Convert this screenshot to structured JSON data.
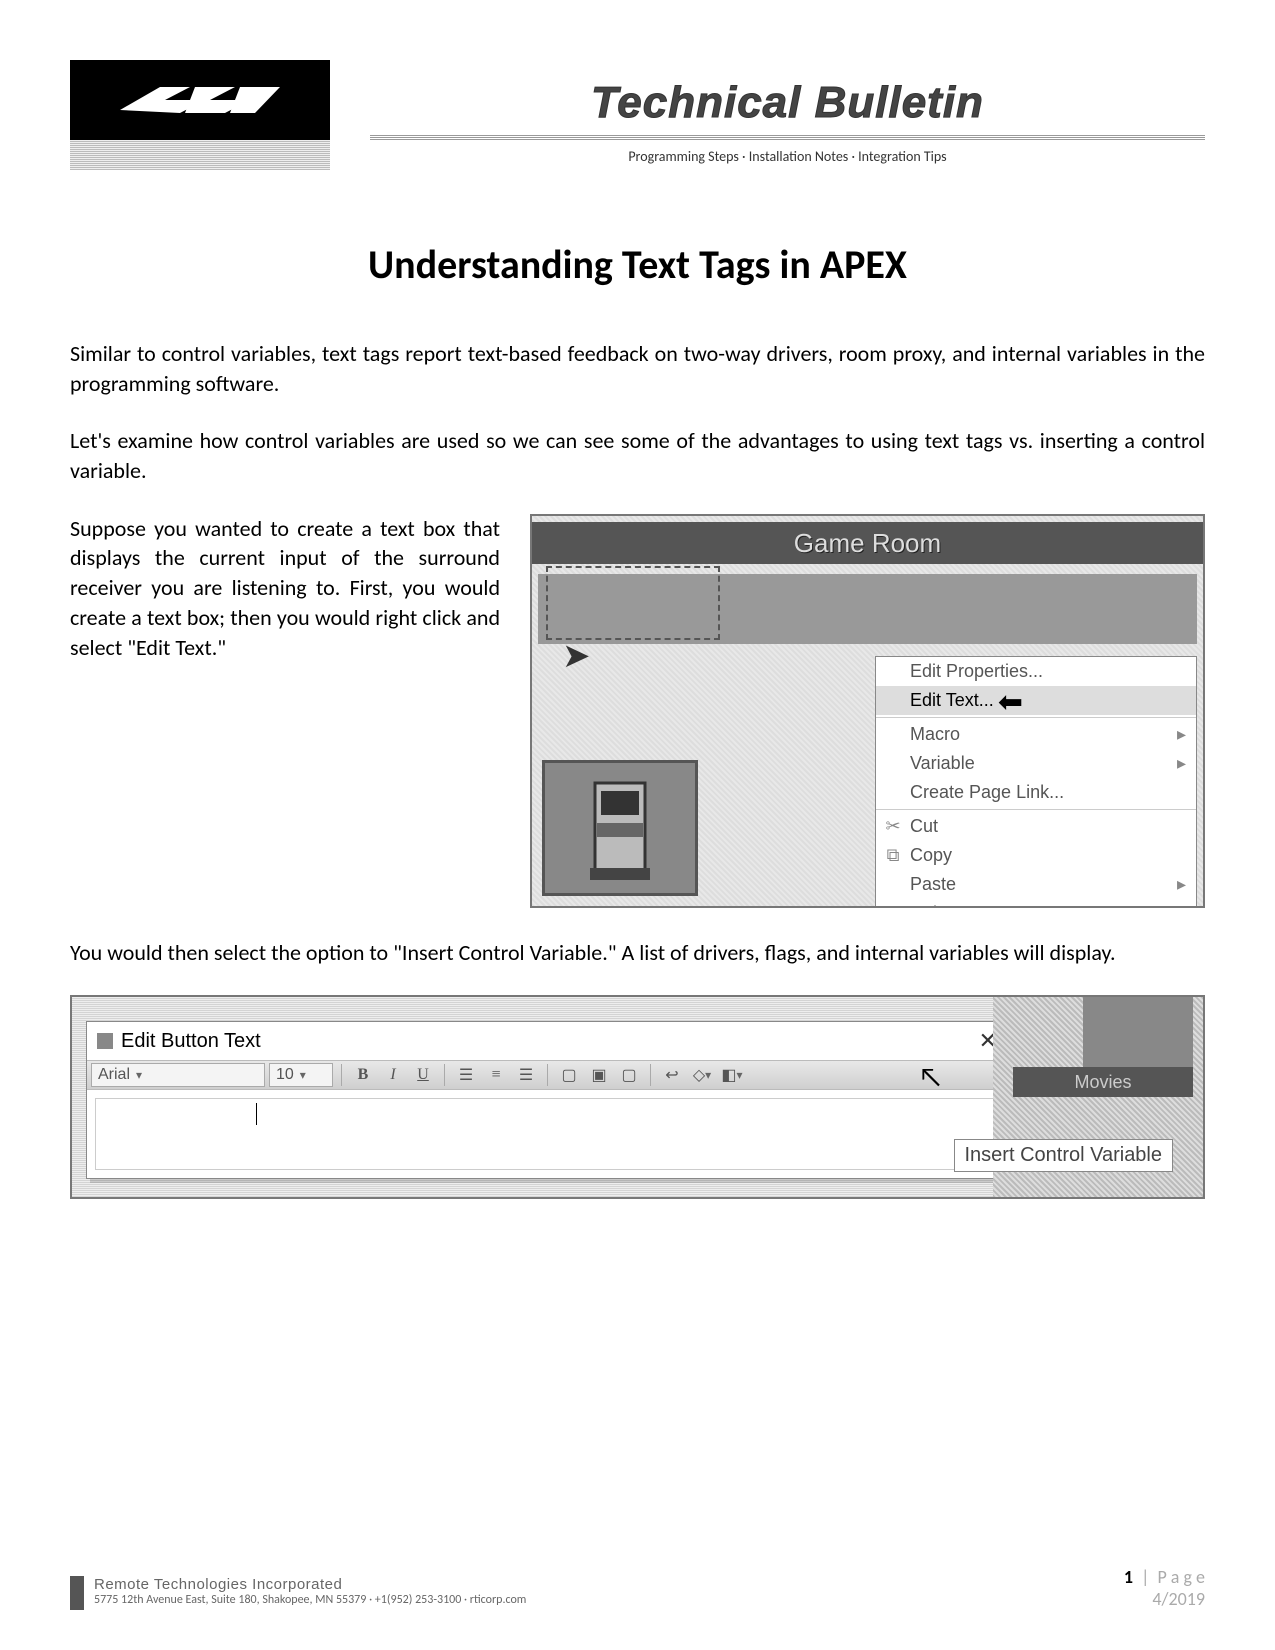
{
  "header": {
    "brand_title": "Technical Bulletin",
    "subtitle": "Programming Steps · Installation Notes · Integration Tips"
  },
  "document": {
    "title": "Understanding Text Tags in APEX",
    "para1": "Similar to control variables, text tags report text-based feedback on two-way drivers, room proxy, and internal variables in the programming software.",
    "para2": "Let's examine how control variables are used so we can see some of the advantages to using text tags vs. inserting a control variable.",
    "para3": "Suppose you wanted to create a text box that displays the current input of the surround receiver you are listening to.  First, you would create a text box; then you would right click and select \"Edit Text.\"",
    "para4": "You would then select the option to \"Insert Control Variable.\"  A list of drivers, flags, and internal variables will display."
  },
  "screenshot1": {
    "room_title": "Game Room",
    "context_menu": [
      {
        "label": "Edit Properties...",
        "submenu": false,
        "highlight": false
      },
      {
        "label": "Edit Text...",
        "submenu": false,
        "highlight": true
      },
      {
        "label": "Macro",
        "submenu": true,
        "highlight": false
      },
      {
        "label": "Variable",
        "submenu": true,
        "highlight": false
      },
      {
        "label": "Create Page Link...",
        "submenu": false,
        "highlight": false
      },
      {
        "label": "Cut",
        "submenu": false,
        "highlight": false,
        "icon": "cut"
      },
      {
        "label": "Copy",
        "submenu": false,
        "highlight": false,
        "icon": "copy"
      },
      {
        "label": "Paste",
        "submenu": true,
        "highlight": false
      },
      {
        "label": "Delete",
        "submenu": false,
        "highlight": false
      }
    ]
  },
  "screenshot2": {
    "dialog_title": "Edit Button Text",
    "font_name": "Arial",
    "font_size": "10",
    "side_label": "Movies",
    "tooltip": "Insert Control Variable"
  },
  "footer": {
    "company": "Remote Technologies Incorporated",
    "address": "5775 12th Avenue East, Suite 180, Shakopee, MN 55379 · +1(952) 253-3100 · rticorp.com",
    "page_number": "1",
    "page_label": "P a g e",
    "date": "4/2019"
  }
}
